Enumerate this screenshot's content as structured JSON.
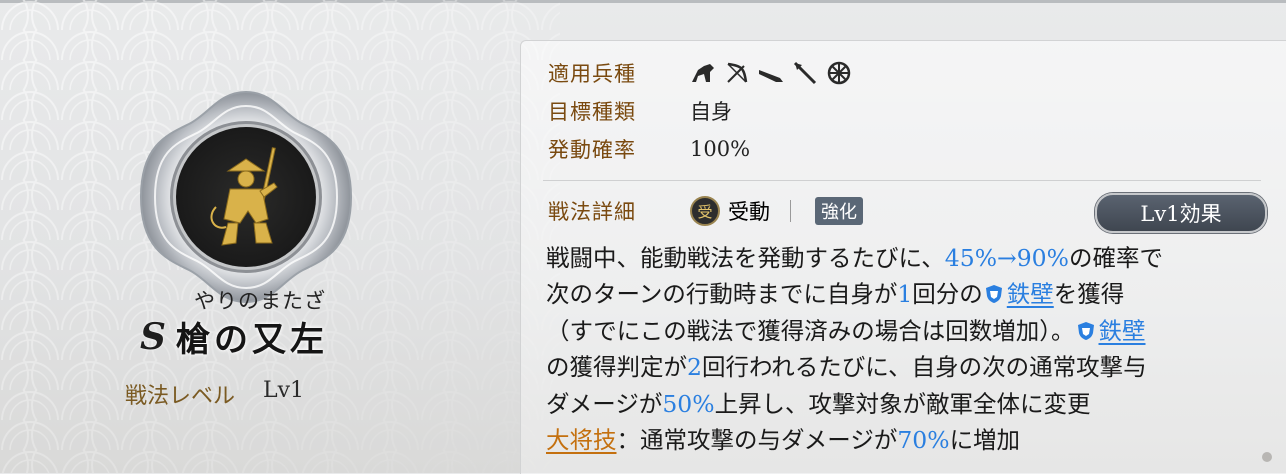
{
  "tactic": {
    "ruby": "やりのまたざ",
    "grade": "S",
    "name": "槍の又左",
    "level_label": "戦法レベル",
    "level_value": "Lv1"
  },
  "info": {
    "troop_label": "適用兵種",
    "troop_icons": [
      "cavalry-icon",
      "bow-icon",
      "gun-icon",
      "spear-icon",
      "wheel-icon"
    ],
    "target_label": "目標種類",
    "target_value": "自身",
    "rate_label": "発動確率",
    "rate_value": "100%"
  },
  "detail": {
    "label": "戦法詳細",
    "passive_icon_char": "受",
    "passive_text": "受動",
    "enhance_tag": "強化",
    "level_button": "Lv1効果"
  },
  "description": {
    "l1a": "戦闘中、能動戦法を発動するたびに、",
    "l1b": "45%→90%",
    "l1c": "の確率で",
    "l2a": "次のターンの行動時までに自身が",
    "l2b": "1",
    "l2c": "回分の",
    "l2d": "鉄壁",
    "l2e": "を獲得",
    "l3a": "（すでにこの戦法で獲得済みの場合は回数増加）。",
    "l3b": "鉄壁",
    "l4a": "の獲得判定が",
    "l4b": "2",
    "l4c": "回行われるたびに、自身の次の通常攻撃与",
    "l5a": "ダメージが",
    "l5b": "50%",
    "l5c": "上昇し、攻撃対象が敵軍全体に変更",
    "l6a": "大将技",
    "l6b": "：通常攻撃の与ダメージが",
    "l6c": "70%",
    "l6d": "に増加"
  },
  "colors": {
    "accent_blue": "#2a7fe0",
    "label_brown": "#7a4a10",
    "general_orange": "#c4700f"
  }
}
